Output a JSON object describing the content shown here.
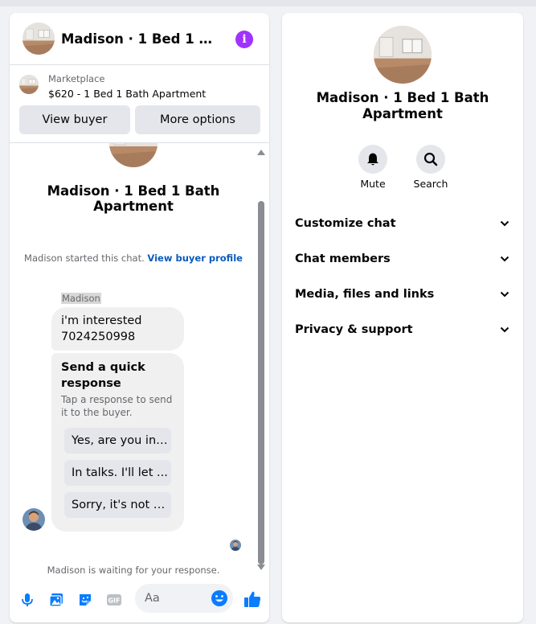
{
  "chat": {
    "title": "Madison · 1 Bed 1 Bath Apartment",
    "listing": {
      "source": "Marketplace",
      "title": "$620 - 1 Bed 1 Bath Apartment"
    },
    "buttons": {
      "view_buyer": "View buyer",
      "more_options": "More options"
    },
    "hero_title": "Madison · 1 Bed 1 Bath Apartment",
    "started_text": "Madison started this chat.",
    "started_link": "View buyer profile",
    "sender_name": "Madison",
    "message_line1": "i'm interested",
    "message_line2": "7024250998",
    "quick": {
      "title": "Send a quick response",
      "subtitle": "Tap a response to send it to the buyer.",
      "options": [
        "Yes, are you int...",
        "In talks. I'll let ...",
        "Sorry, it's not a..."
      ]
    },
    "waiting": "Madison is waiting for your response.",
    "composer": {
      "placeholder": "Aa"
    },
    "icons": [
      "info-icon",
      "microphone-icon",
      "photo-icon",
      "sticker-icon",
      "gif-icon",
      "emoji-icon",
      "thumbs-up-icon",
      "chevron-down-icon",
      "bell-icon",
      "search-icon"
    ]
  },
  "info": {
    "title": "Madison · 1 Bed 1 Bath Apartment",
    "actions": {
      "mute": "Mute",
      "search": "Search"
    },
    "sections": [
      "Customize chat",
      "Chat members",
      "Media, files and links",
      "Privacy & support"
    ]
  },
  "colors": {
    "accent": "#0a7cff",
    "info_badge": "#a033ff",
    "link": "#0a5bbd"
  }
}
